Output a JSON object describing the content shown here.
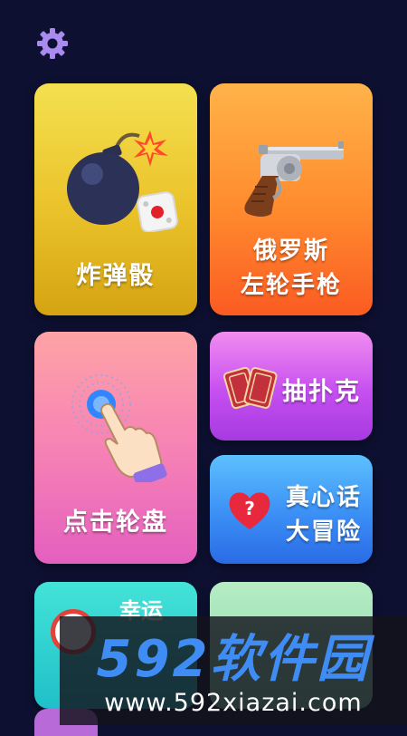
{
  "header": {
    "settings_icon": "gear-icon"
  },
  "cards": {
    "bomb": {
      "label": "炸弹骰",
      "icon": "bomb-dice-icon"
    },
    "revolver": {
      "line1": "俄罗斯",
      "line2": "左轮手枪",
      "icon": "revolver-icon"
    },
    "wheel": {
      "label": "点击轮盘",
      "icon": "tap-hand-icon"
    },
    "poker": {
      "label": "抽扑克",
      "icon": "playing-cards-icon"
    },
    "truth": {
      "line1": "真心话",
      "line2": "大冒险",
      "icon": "heart-question-icon"
    },
    "bottom_left": {
      "label": "幸运"
    }
  },
  "watermark": {
    "brand": "592软件园",
    "url": "www.592xiazai.com"
  },
  "colors": {
    "background": "#0d1030",
    "gear": "#a98bf0",
    "bomb_card": "#eac22a",
    "revolver_card": "#ff8a2e",
    "wheel_card": "#f57fb6",
    "poker_card": "#c64ff0",
    "truth_card": "#3b8ff5",
    "watermark_brand": "#3f8cf4"
  }
}
